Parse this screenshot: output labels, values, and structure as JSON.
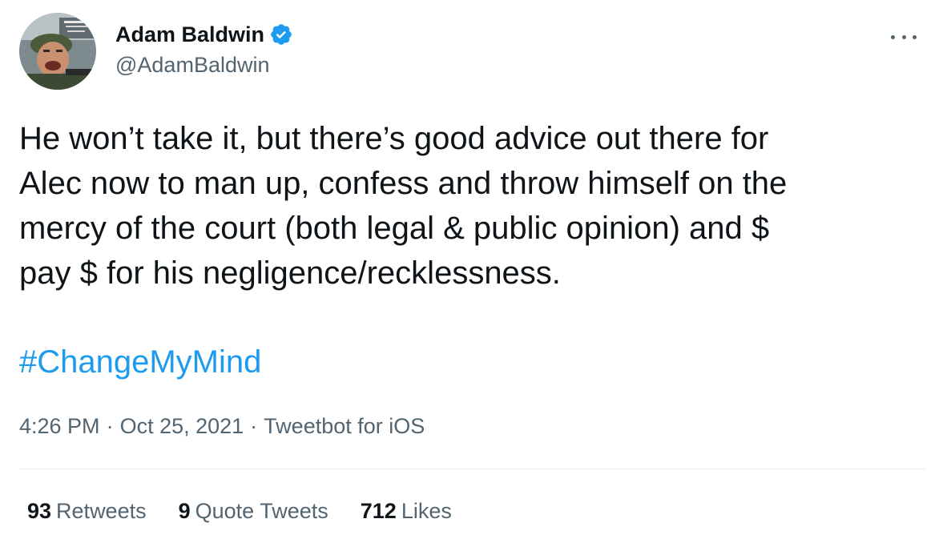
{
  "author": {
    "name": "Adam Baldwin",
    "handle": "@AdamBaldwin",
    "verified": true,
    "avatar_icon": "avatar-soldier-photo"
  },
  "tweet": {
    "text": "He won’t take it, but there’s good advice out there for\nAlec now to man up, confess and throw himself on the\nmercy of the court (both legal & public opinion) and $\npay $ for his negligence/recklessness.",
    "hashtag": "#ChangeMyMind",
    "time": "4:26 PM",
    "date": "Oct 25, 2021",
    "source": "Tweetbot for iOS",
    "separator": "·"
  },
  "stats": {
    "retweets_count": "93",
    "retweets_label": "Retweets",
    "quotes_count": "9",
    "quotes_label": "Quote Tweets",
    "likes_count": "712",
    "likes_label": "Likes"
  },
  "colors": {
    "text": "#0f1419",
    "secondary": "#536471",
    "link": "#1d9bf0",
    "divider": "#e6ecf0",
    "verified": "#1d9bf0"
  },
  "icons": {
    "more": "more-horizontal-icon",
    "verified": "verified-badge-icon"
  }
}
